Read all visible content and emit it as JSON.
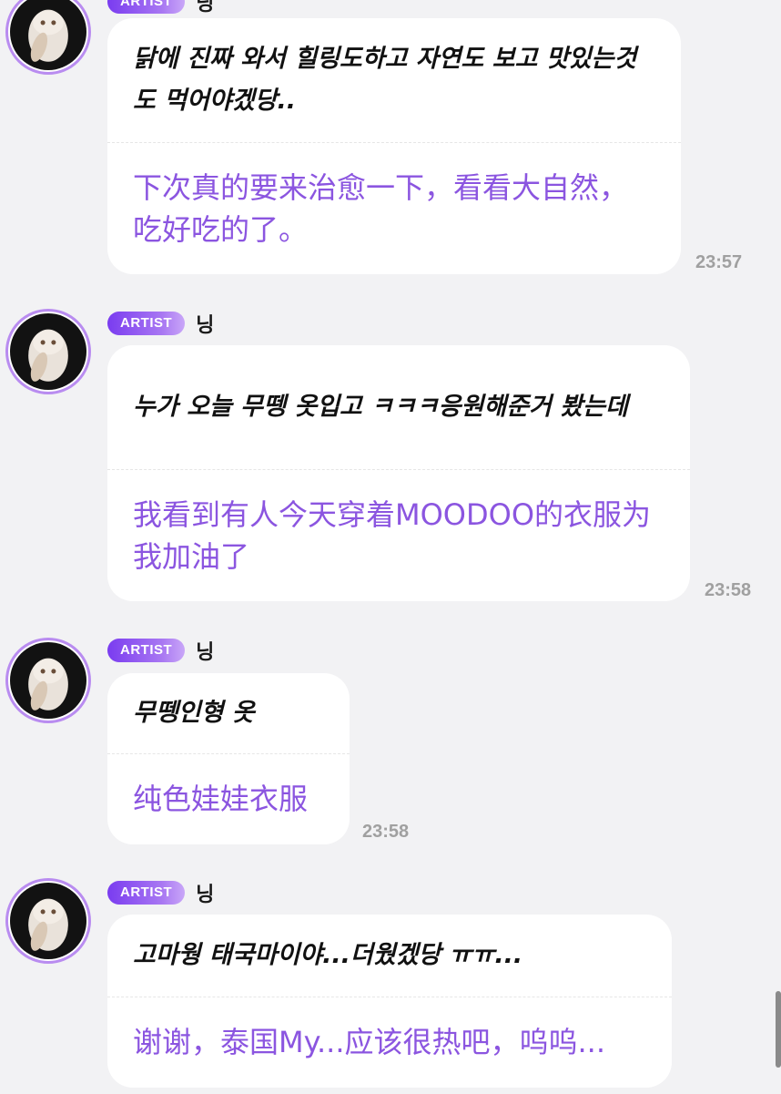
{
  "badge_label": "ARTIST",
  "sender_name": "닝",
  "messages": [
    {
      "original": "닭에 진짜 와서 힐링도하고 자연도 보고 맛있는것도 먹어야겠당..",
      "translation": "下次真的要来治愈一下，看看大自然，吃好吃的了。",
      "time": "23:57"
    },
    {
      "original": "누가 오늘 무뗑 옷입고 ㅋㅋㅋ응원해준거 봤는데",
      "translation": "我看到有人今天穿着MOODOO的衣服为我加油了",
      "time": "23:58"
    },
    {
      "original": "무뗑인형 옷",
      "translation": "纯色娃娃衣服",
      "time": "23:58"
    },
    {
      "original": "고마웡 태국마이야...더웠겠당 ㅠㅠ...",
      "translation": "谢谢，泰国My...应该很热吧，呜呜...",
      "time": ""
    }
  ],
  "colors": {
    "background": "#f2f2f4",
    "bubble": "#ffffff",
    "translation_text": "#8b55e0",
    "badge_gradient_start": "#7a3cf0",
    "badge_gradient_end": "#c9a6f8",
    "timestamp": "#a0a0a0"
  },
  "icons": {
    "avatar": "cat-photo-avatar"
  }
}
